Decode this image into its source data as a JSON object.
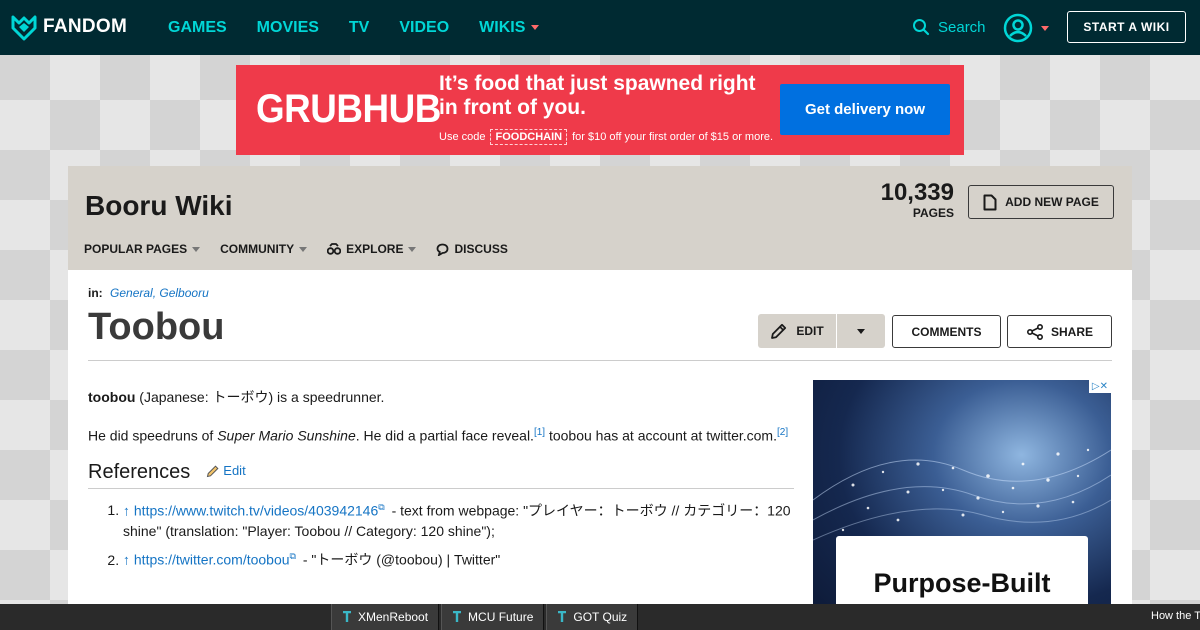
{
  "topnav": {
    "logo_text": "FANDOM",
    "links": [
      "GAMES",
      "MOVIES",
      "TV",
      "VIDEO",
      "WIKIS"
    ],
    "search_label": "Search",
    "start_wiki_label": "START A WIKI"
  },
  "ad_banner": {
    "brand": "GRUBHUB",
    "headline": "It’s food that just spawned right in front of you.",
    "sub_prefix": "Use code",
    "code": "FOODCHAIN",
    "sub_suffix": "for $10 off your first order of $15 or more.",
    "cta": "Get delivery now"
  },
  "wiki": {
    "name": "Booru Wiki",
    "page_count": "10,339",
    "pages_label": "PAGES",
    "add_new_page_label": "ADD NEW PAGE",
    "nav": [
      {
        "label": "POPULAR PAGES"
      },
      {
        "label": "COMMUNITY"
      },
      {
        "label": "EXPLORE"
      },
      {
        "label": "DISCUSS"
      }
    ]
  },
  "page": {
    "in_label": "in:",
    "categories": "General, Gelbooru",
    "title": "Toobou",
    "edit_label": "EDIT",
    "comments_label": "COMMENTS",
    "share_label": "SHARE"
  },
  "article": {
    "p1_bold": "toobou",
    "p1_rest": " (Japanese: トーボウ) is a speedrunner.",
    "p2_a": "He did speedruns of ",
    "p2_italic": "Super Mario Sunshine",
    "p2_b": ". He did a partial face reveal.",
    "p2_sup1": "[1]",
    "p2_c": " toobou has at account at twitter.com.",
    "p2_sup2": "[2]",
    "refs_title": "References",
    "refs_edit": "Edit",
    "refs": [
      {
        "arrow": "↑",
        "url": "https://www.twitch.tv/videos/403942146",
        "text": " - text from webpage: \"プレイヤー：トーボウ // カテゴリー：120 shine\" (translation: \"Player: Toobou // Category: 120 shine\");"
      },
      {
        "arrow": "↑",
        "url": "https://twitter.com/toobou",
        "text": " - \"トーボウ (@toobou) | Twitter\""
      }
    ]
  },
  "side_ad": {
    "text": "Purpose-Built"
  },
  "bottom_bar": {
    "items": [
      "XMenReboot",
      "MCU Future",
      "GOT Quiz"
    ],
    "right_text": "How the T"
  },
  "colors": {
    "nav_bg": "#002a32",
    "nav_link": "#00d6d6",
    "accent_caret": "#ff6a6a",
    "wiki_header_bg": "#d6d2cb",
    "link": "#1574c4",
    "ad_red": "#ef3a4a",
    "ad_blue": "#0070e0"
  }
}
